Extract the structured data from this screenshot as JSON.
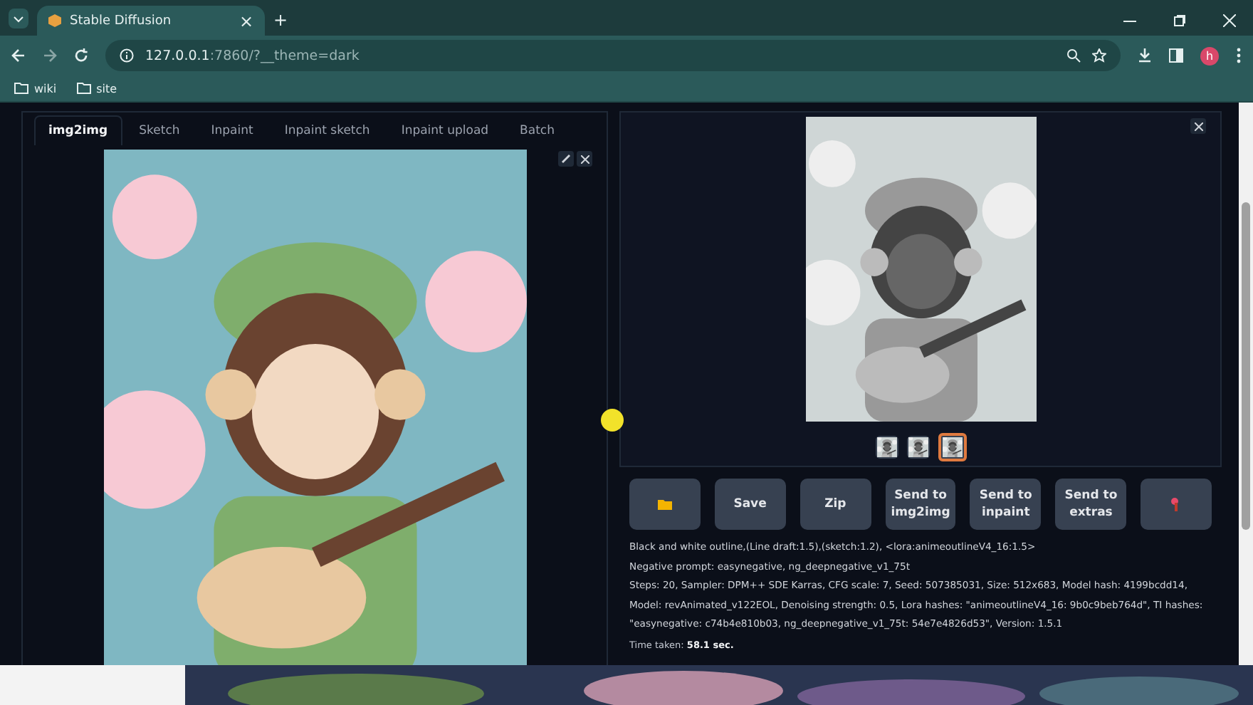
{
  "browser": {
    "tab_title": "Stable Diffusion",
    "tab_close": "×",
    "new_tab": "+",
    "url_host": "127.0.0.1",
    "url_rest": ":7860/?__theme=dark",
    "profile": "h",
    "bookmarks": [
      "wiki",
      "site"
    ]
  },
  "tabs": [
    {
      "label": "img2img",
      "selected": true
    },
    {
      "label": "Sketch",
      "selected": false
    },
    {
      "label": "Inpaint",
      "selected": false
    },
    {
      "label": "Inpaint sketch",
      "selected": false
    },
    {
      "label": "Inpaint upload",
      "selected": false
    },
    {
      "label": "Batch",
      "selected": false
    }
  ],
  "thumbnails": [
    {
      "selected": false
    },
    {
      "selected": false
    },
    {
      "selected": true
    }
  ],
  "buttons": [
    {
      "kind": "folder"
    },
    {
      "kind": "text",
      "label": "Save"
    },
    {
      "kind": "text",
      "label": "Zip"
    },
    {
      "kind": "text",
      "label": "Send to img2img"
    },
    {
      "kind": "text",
      "label": "Send to inpaint"
    },
    {
      "kind": "text",
      "label": "Send to extras"
    },
    {
      "kind": "paint"
    }
  ],
  "info": {
    "prompt": "Black and white outline,(Line draft:1.5),(sketch:1.2), <lora:animeoutlineV4_16:1.5>",
    "negative": "Negative prompt: easynegative, ng_deepnegative_v1_75t",
    "params": "Steps: 20, Sampler: DPM++ SDE Karras, CFG scale: 7, Seed: 507385031, Size: 512x683, Model hash: 4199bcdd14, Model: revAnimated_v122EOL, Denoising strength: 0.5, Lora hashes: \"animeoutlineV4_16: 9b0c9beb764d\", TI hashes: \"easynegative: c74b4e810b03, ng_deepnegative_v1_75t: 54e7e4826d53\", Version: 1.5.1",
    "time": "Time taken: **58.1 sec.**"
  }
}
